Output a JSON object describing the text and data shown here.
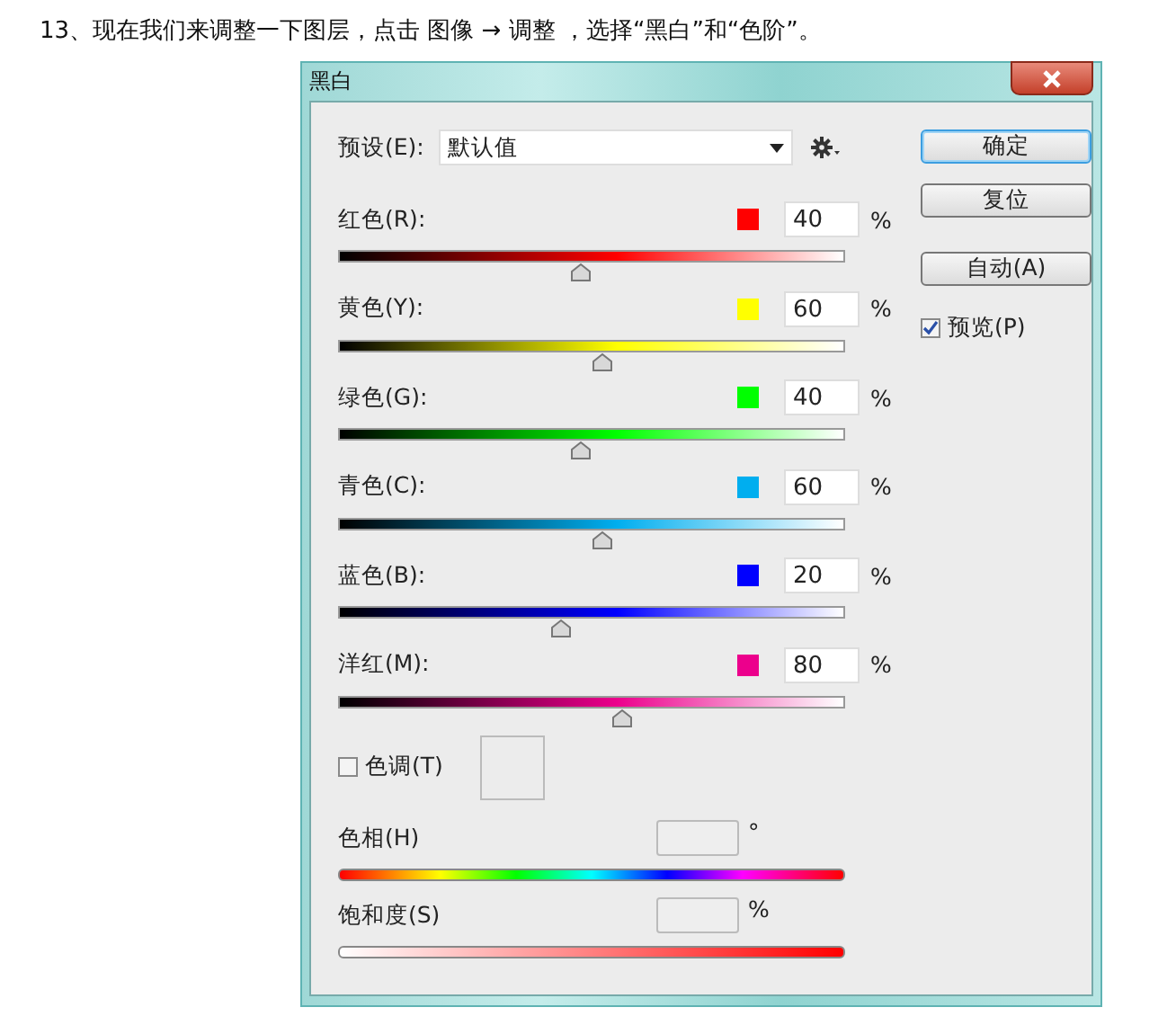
{
  "caption": "13、现在我们来调整一下图层，点击 图像 → 调整 ，选择“黑白”和“色阶”。",
  "window": {
    "title": "黑白"
  },
  "preset": {
    "label": "预设(E):",
    "value": "默认值"
  },
  "channels": [
    {
      "name": "红色(R):",
      "color": "#ff0000",
      "value": "40",
      "unit": "%",
      "level": 0.48
    },
    {
      "name": "黄色(Y):",
      "color": "#ffff00",
      "value": "60",
      "unit": "%",
      "level": 0.52
    },
    {
      "name": "绿色(G):",
      "color": "#00ff00",
      "value": "40",
      "unit": "%",
      "level": 0.48
    },
    {
      "name": "青色(C):",
      "color": "#00aeef",
      "value": "60",
      "unit": "%",
      "level": 0.52
    },
    {
      "name": "蓝色(B):",
      "color": "#0000ff",
      "value": "20",
      "unit": "%",
      "level": 0.44
    },
    {
      "name": "洋红(M):",
      "color": "#ec008c",
      "value": "80",
      "unit": "%",
      "level": 0.56
    }
  ],
  "tint": {
    "label": "色调(T)",
    "checked": false
  },
  "hue": {
    "label": "色相(H)",
    "unit": "°"
  },
  "saturation": {
    "label": "饱和度(S)",
    "unit": "%"
  },
  "buttons": [
    {
      "label": "确定",
      "default": true
    },
    {
      "label": "复位",
      "default": false
    },
    {
      "label": "自动(A)",
      "default": false
    }
  ],
  "preview": {
    "label": "预览(P)",
    "checked": true
  }
}
